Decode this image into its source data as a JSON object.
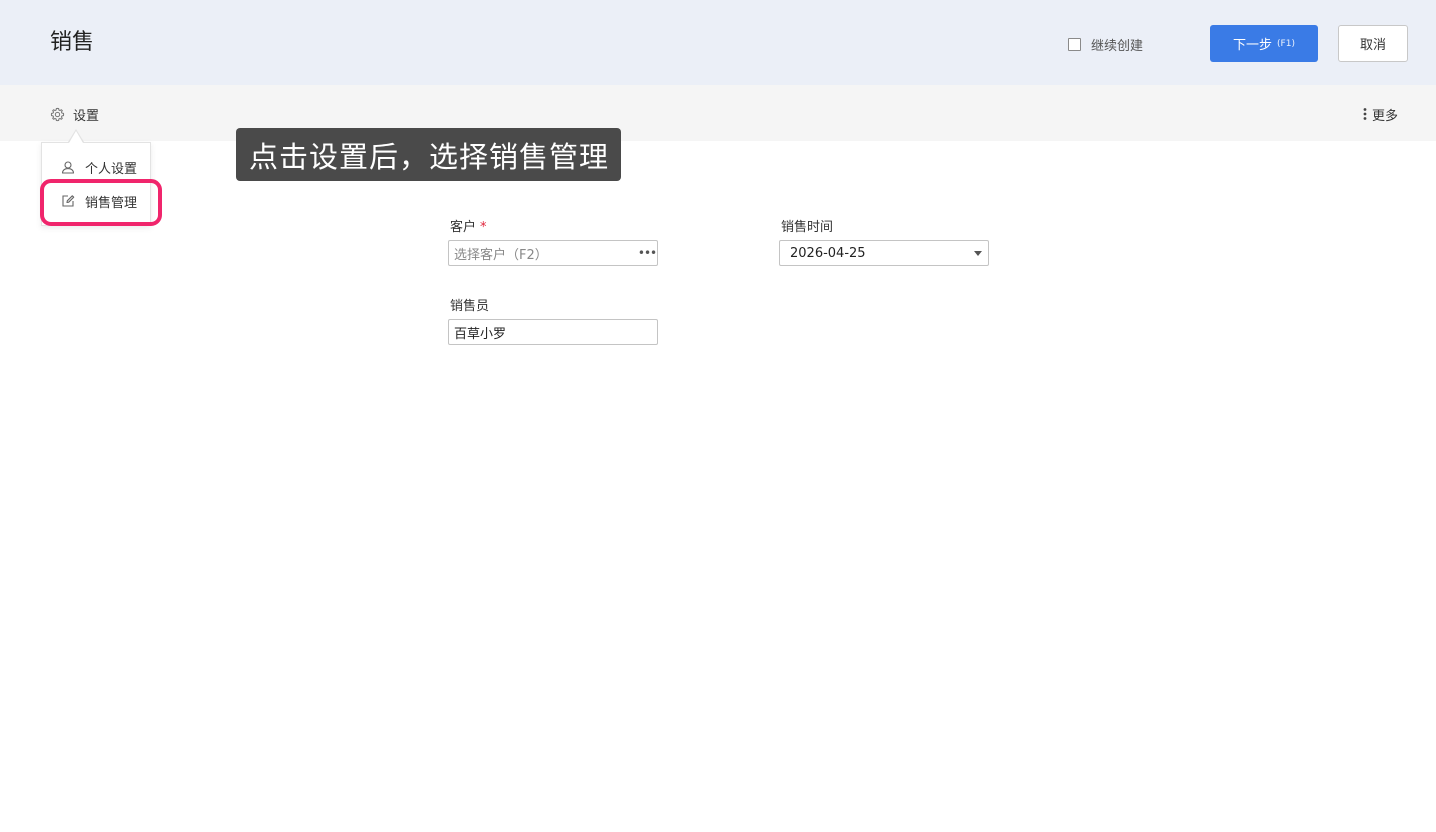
{
  "header": {
    "title": "销售",
    "continue_create_label": "继续创建",
    "continue_create_checked": false,
    "next_label": "下一步",
    "next_hotkey": "(F1)",
    "cancel_label": "取消",
    "next_button_color": "#3a7be6"
  },
  "toolbar": {
    "settings_label": "设置",
    "settings_icon": "gear-icon",
    "more_label": "更多",
    "more_icon": "vertical-dots-icon"
  },
  "settings_menu": {
    "items": [
      {
        "label": "个人设置",
        "icon": "user-icon"
      },
      {
        "label": "销售管理",
        "icon": "edit-icon"
      }
    ],
    "highlight_color": "#f0256c"
  },
  "tooltip": {
    "text": "点击设置后，选择销售管理"
  },
  "form": {
    "customer": {
      "label": "客户",
      "required_mark": "*",
      "placeholder": "选择客户（F2）",
      "value": ""
    },
    "sale_time": {
      "label": "销售时间",
      "value": "2026-04-25"
    },
    "salesperson": {
      "label": "销售员",
      "value": "百草小罗"
    }
  }
}
